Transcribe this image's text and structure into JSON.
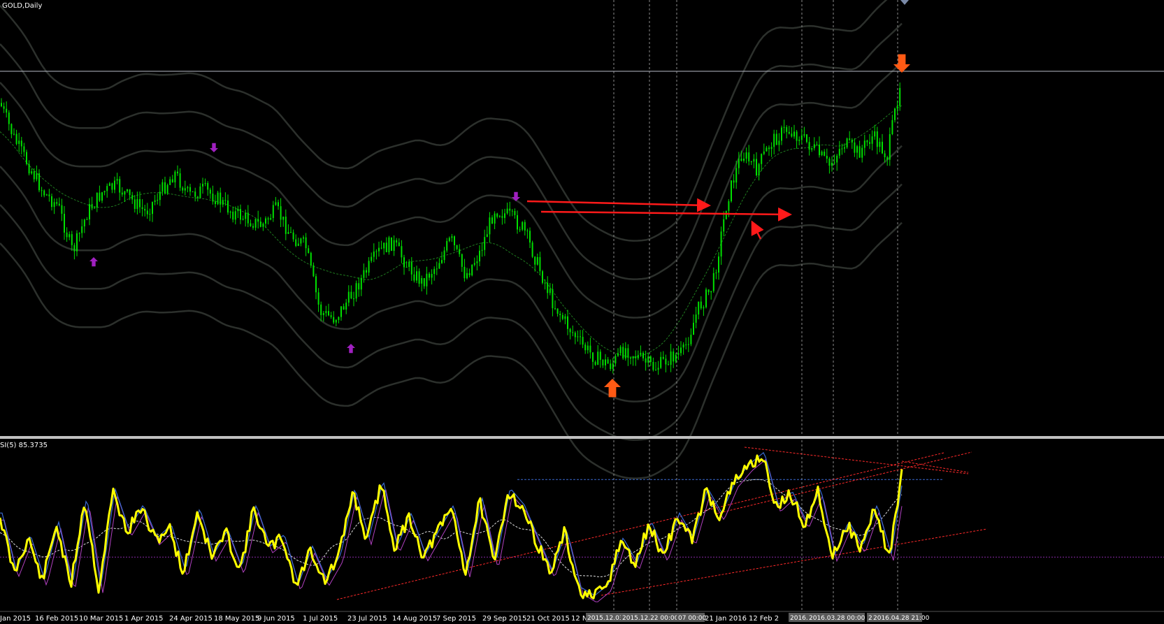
{
  "window": {
    "title": "GOLD,Daily",
    "indicator_label": "SI(5) 85.3735"
  },
  "colors": {
    "background": "#000000",
    "candle": "#00e000",
    "envelope": "#2c302c",
    "midline": "#1f7a1f",
    "hline": "#b8bcc8",
    "arrow_red": "#ff1a1a",
    "signal_orange": "#ff5a14",
    "signal_purple": "#a020c0",
    "osc_main": "#ffff00",
    "osc_blue": "#3a6ad0",
    "osc_purple": "#b040c0",
    "osc_signal": "#e0e0e0",
    "trend_red": "#ff2a2a",
    "level_blue": "#3a6ad0",
    "level_purple": "#8a2aa8",
    "separator": "#c0c0c0"
  },
  "axis": {
    "date_labels": [
      "Jan 2015",
      "16 Feb 2015",
      "10 Mar 2015",
      "1 Apr 2015",
      "24 Apr 2015",
      "18 May 2015",
      "9 Jun 2015",
      "1 Jul 2015",
      "23 Jul 2015",
      "14 Aug 2015",
      "7 Sep 2015",
      "29 Sep 2015",
      "21 Oct 2015",
      "12 Nov",
      "21 Jan 2016",
      "12 Feb 2"
    ],
    "vline_timestamps": [
      "2015.12.03",
      "2015.12.22 00:00",
      "07 00:00",
      "2016.03.1",
      "2016.03.28 00:00",
      "201",
      "2016.04.28 21:00"
    ]
  },
  "chart_data": [
    {
      "type": "candlestick",
      "title": "GOLD,Daily",
      "x_range": [
        "2015-01",
        "2016-04-28"
      ],
      "series": [
        {
          "name": "price",
          "values": [
            0.89,
            0.78,
            0.7,
            0.62,
            0.58,
            0.44,
            0.56,
            0.62,
            0.64,
            0.6,
            0.56,
            0.62,
            0.68,
            0.61,
            0.63,
            0.6,
            0.56,
            0.54,
            0.52,
            0.57,
            0.49,
            0.46,
            0.26,
            0.24,
            0.3,
            0.37,
            0.44,
            0.47,
            0.4,
            0.35,
            0.4,
            0.48,
            0.37,
            0.44,
            0.57,
            0.55,
            0.51,
            0.4,
            0.29,
            0.22,
            0.16,
            0.12,
            0.1,
            0.15,
            0.12,
            0.09,
            0.12,
            0.14,
            0.27,
            0.34,
            0.6,
            0.74,
            0.69,
            0.77,
            0.81,
            0.79,
            0.75,
            0.7,
            0.77,
            0.74,
            0.79,
            0.73,
            0.98
          ]
        }
      ]
    },
    {
      "type": "line",
      "title": "SI(5) 85.3735",
      "ylim": [
        0,
        100
      ],
      "series": [
        {
          "name": "SI(5)",
          "values": [
            55,
            20,
            42,
            15,
            50,
            12,
            65,
            10,
            70,
            45,
            60,
            40,
            48,
            20,
            58,
            30,
            45,
            22,
            60,
            35,
            42,
            12,
            35,
            15,
            30,
            70,
            40,
            75,
            35,
            55,
            30,
            45,
            60,
            20,
            65,
            25,
            70,
            60,
            40,
            20,
            45,
            10,
            5,
            12,
            40,
            25,
            50,
            30,
            55,
            40,
            70,
            55,
            75,
            85,
            92,
            60,
            68,
            50,
            70,
            30,
            50,
            35,
            60,
            30,
            85.3735
          ]
        }
      ],
      "guides": {
        "purple_level": 30,
        "blue_level": 77
      }
    }
  ]
}
